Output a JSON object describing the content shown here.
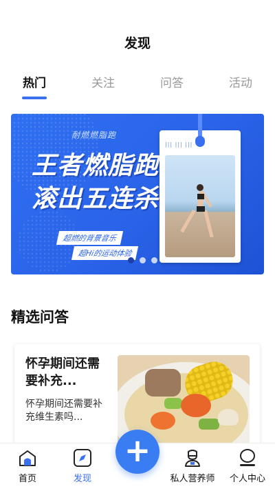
{
  "header": {
    "title": "发现"
  },
  "tabs": [
    {
      "label": "热门",
      "active": true
    },
    {
      "label": "关注",
      "active": false
    },
    {
      "label": "问答",
      "active": false
    },
    {
      "label": "活动",
      "active": false
    }
  ],
  "banner": {
    "small_text": "耐燃燃脂跑",
    "headline_1": "王者燃脂跑",
    "headline_2": "滚出五连杀",
    "tag_1": "超燃的背景音乐",
    "tag_2": "超Hi的运动体验",
    "card_stripes": "||| ||| |||",
    "slides": 3,
    "active_slide": 1
  },
  "section": {
    "title": "精选问答"
  },
  "qa_card": {
    "title": "怀孕期间还需要补充...",
    "description": "怀孕期间还需要补充维生素吗..."
  },
  "tabbar": {
    "items": [
      {
        "label": "首页",
        "icon": "home-icon",
        "active": false
      },
      {
        "label": "发现",
        "icon": "compass-icon",
        "active": true
      },
      {
        "label": "私人营养师",
        "icon": "chef-icon",
        "active": false
      },
      {
        "label": "个人中心",
        "icon": "user-icon",
        "active": false
      }
    ],
    "fab_label": "+"
  },
  "colors": {
    "accent": "#3a6ff0",
    "banner_blue": "#2a63e8",
    "fab": "#3a7cf2"
  }
}
